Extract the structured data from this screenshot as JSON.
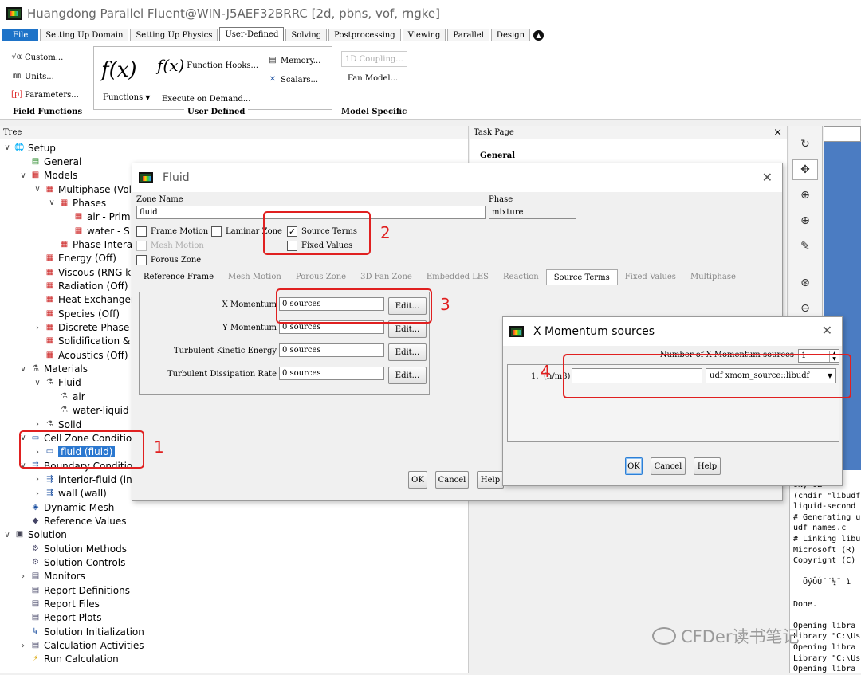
{
  "app": {
    "title": "Huangdong Parallel Fluent@WIN-J5AEF32BRRC  [2d, pbns, vof, rngke]"
  },
  "ribbon_tabs": [
    "File",
    "Setting Up Domain",
    "Setting Up Physics",
    "User-Defined",
    "Solving",
    "Postprocessing",
    "Viewing",
    "Parallel",
    "Design"
  ],
  "ribbon": {
    "field_functions": {
      "custom": "Custom...",
      "units": "Units...",
      "parameters": "Parameters...",
      "group": "Field Functions"
    },
    "user_defined": {
      "fx": "f(x)",
      "functions": "Functions",
      "function_hooks": "Function Hooks...",
      "execute_on_demand": "Execute on Demand...",
      "memory": "Memory...",
      "scalars": "Scalars...",
      "group": "User Defined"
    },
    "model_specific": {
      "coupling": "1D Coupling...",
      "fan_model": "Fan Model...",
      "group": "Model Specific"
    }
  },
  "tree": {
    "header": "Tree",
    "items": [
      "Setup",
      "General",
      "Models",
      "Multiphase (Volu",
      "Phases",
      "air - Prim",
      "water - S",
      "Phase Intera",
      "Energy (Off)",
      "Viscous (RNG k-",
      "Radiation (Off)",
      "Heat Exchanger",
      "Species (Off)",
      "Discrete Phase (",
      "Solidification &",
      "Acoustics (Off)",
      "Materials",
      "Fluid",
      "air",
      "water-liquid",
      "Solid",
      "Cell Zone Condition",
      "fluid (fluid)",
      "Boundary Conditio",
      "interior-fluid (int",
      "wall (wall)",
      "Dynamic Mesh",
      "Reference Values",
      "Solution",
      "Solution Methods",
      "Solution Controls",
      "Monitors",
      "Report Definitions",
      "Report Files",
      "Report Plots",
      "Solution Initialization",
      "Calculation Activities",
      "Run Calculation"
    ]
  },
  "task_page": {
    "header": "Task Page",
    "general": "General",
    "close": "×"
  },
  "console": {
    "lines": [
      "ON, OZ",
      "(chdir \"libudf",
      "liquid-second",
      "# Generating u",
      "udf_names.c",
      "# Linking libu",
      "Microsoft (R)",
      "Copyright (C)",
      "",
      "  ÕýÔÚ´´½¨ ì",
      "",
      "Done.",
      "",
      "Opening libra",
      "Library \"C:\\Us",
      "Opening libra",
      "Library \"C:\\Us",
      "Opening libra"
    ]
  },
  "fluid_dialog": {
    "title": "Fluid",
    "zone_name_label": "Zone Name",
    "zone_name": "fluid",
    "phase_label": "Phase",
    "phase": "mixture",
    "frame_motion": "Frame Motion",
    "laminar_zone": "Laminar Zone",
    "source_terms": "Source Terms",
    "fixed_values": "Fixed Values",
    "mesh_motion": "Mesh Motion",
    "porous_zone": "Porous Zone",
    "tabs": [
      "Reference Frame",
      "Mesh Motion",
      "Porous Zone",
      "3D Fan Zone",
      "Embedded LES",
      "Reaction",
      "Source Terms",
      "Fixed Values",
      "Multiphase"
    ],
    "rows": [
      {
        "label": "X Momentum",
        "value": "0 sources",
        "btn": "Edit..."
      },
      {
        "label": "Y Momentum",
        "value": "0 sources",
        "btn": "Edit..."
      },
      {
        "label": "Turbulent Kinetic Energy",
        "value": "0 sources",
        "btn": "Edit..."
      },
      {
        "label": "Turbulent Dissipation Rate",
        "value": "0 sources",
        "btn": "Edit..."
      }
    ],
    "ok": "OK",
    "cancel": "Cancel",
    "help": "Help"
  },
  "xmom_dialog": {
    "title": "X Momentum sources",
    "count_label": "Number of X-Momentum sources",
    "count": "1",
    "row_index": "1.",
    "row_unit": "(n/m3)",
    "row_value": "",
    "udf": "udf xmom_source::libudf",
    "ok": "OK",
    "cancel": "Cancel",
    "help": "Help"
  },
  "annotations": [
    "1",
    "2",
    "3",
    "4"
  ],
  "watermark": "CFDer读书笔记"
}
